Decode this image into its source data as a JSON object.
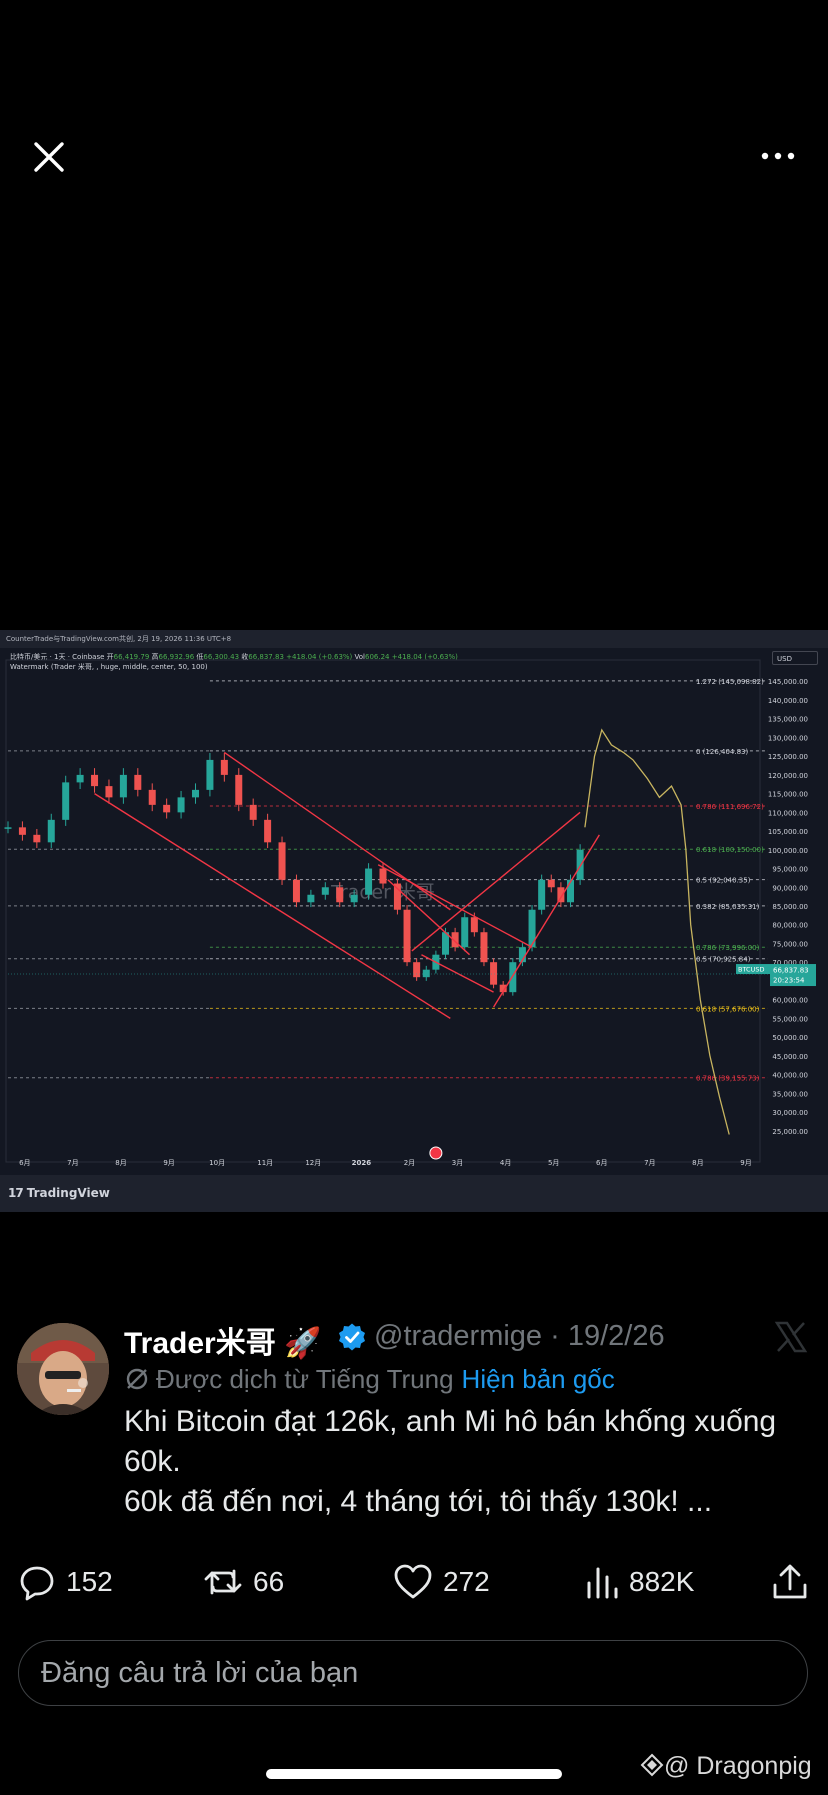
{
  "top_bar": {
    "close_icon": "close-icon",
    "more_icon": "more-horizontal-icon"
  },
  "chart_image": {
    "source_header": "CounterTrade与TradingView.com共创, 2月 19, 2026 11:36 UTC+8",
    "info_line_prefix": "比特币/美元 · 1天 · Coinbase  开",
    "open": "66,419.79",
    "high_label": "高",
    "high": "66,932.96",
    "low_label": "低",
    "low": "66,300.43",
    "close_label": "收",
    "close": "66,837.83",
    "change": "+418.04 (+0.63%)",
    "vol_label": "Vol",
    "vol": "606.24",
    "vol_change": "+418.04 (+0.63%)",
    "watermark_line": "Watermark (Trader 米哥, , huge, middle, center, 50, 100)",
    "currency": "USD",
    "watermark_text": "Trader 米哥",
    "brand": "TradingView",
    "price_tag": {
      "symbol": "BTCUSD",
      "price": "66,837.83",
      "time": "20:23:54"
    }
  },
  "chart_data": {
    "type": "line",
    "title": "",
    "xlabel": "",
    "ylabel": "",
    "x_ticks": [
      "6月",
      "7月",
      "8月",
      "9月",
      "10月",
      "11月",
      "12月",
      "2026",
      "2月",
      "3月",
      "4月",
      "5月",
      "6月",
      "7月",
      "8月",
      "9月"
    ],
    "y_ticks": [
      "145,000.00",
      "140,000.00",
      "135,000.00",
      "130,000.00",
      "125,000.00",
      "120,000.00",
      "115,000.00",
      "110,000.00",
      "105,000.00",
      "100,000.00",
      "95,000.00",
      "90,000.00",
      "85,000.00",
      "80,000.00",
      "75,000.00",
      "70,000.00",
      "65,000.00",
      "60,000.00",
      "55,000.00",
      "50,000.00",
      "45,000.00",
      "40,000.00",
      "35,000.00",
      "30,000.00",
      "25,000.00"
    ],
    "ylim": [
      22000,
      148000
    ],
    "xlim": [
      0,
      15.6
    ],
    "grid": false,
    "fib_levels": [
      {
        "label": "1.272 (145,098.82)",
        "value": 145098.82,
        "color": "#d1d4dc"
      },
      {
        "label": "0 (126,404.83)",
        "value": 126404.83,
        "color": "#d1d4dc"
      },
      {
        "label": "0.786 (111,696.72)",
        "value": 111696.72,
        "color": "#f23645"
      },
      {
        "label": "0.618 (100,150.00)",
        "value": 100150,
        "color": "#4caf50"
      },
      {
        "label": "0.5 (92,040.35)",
        "value": 92040.35,
        "color": "#d1d4dc"
      },
      {
        "label": "0.382 (85,035.31)",
        "value": 85035.31,
        "color": "#d1d4dc"
      },
      {
        "label": "0.786 (73,996.00)",
        "value": 73996,
        "color": "#4caf50"
      },
      {
        "label": "0.5 (70,925.84)",
        "value": 70925.84,
        "color": "#d1d4dc"
      },
      {
        "label": "0.618 (57,676.00)",
        "value": 57676,
        "color": "#f0c419"
      },
      {
        "label": "0.786 (39,155.73)",
        "value": 39155.73,
        "color": "#f23645"
      }
    ],
    "series": [
      {
        "style": "candles",
        "color_up": "#26a69a",
        "color_down": "#ef5350",
        "x": [
          0,
          0.3,
          0.6,
          0.9,
          1.2,
          1.5,
          1.8,
          2.1,
          2.4,
          2.7,
          3.0,
          3.3,
          3.6,
          3.9,
          4.2,
          4.5,
          4.8,
          5.1,
          5.4,
          5.7,
          6.0,
          6.3,
          6.6,
          6.9,
          7.2,
          7.5,
          7.8,
          8.1,
          8.3,
          8.5,
          8.7,
          8.9,
          9.1,
          9.3,
          9.5,
          9.7,
          9.9,
          10.1,
          10.3,
          10.5,
          10.7,
          10.9,
          11.1,
          11.3,
          11.5,
          11.7,
          11.9
        ],
        "values": [
          106000,
          104000,
          102000,
          108000,
          118000,
          120000,
          117000,
          114000,
          120000,
          116000,
          112000,
          110000,
          114000,
          116000,
          124000,
          120000,
          112000,
          108000,
          102000,
          92000,
          86000,
          88000,
          90000,
          86000,
          88000,
          95000,
          91000,
          84000,
          70000,
          66000,
          68000,
          72000,
          78000,
          74000,
          82000,
          78000,
          70000,
          64000,
          62000,
          70000,
          74000,
          84000,
          92000,
          90000,
          86000,
          92000,
          100000
        ]
      },
      {
        "style": "projection",
        "color": "#c8b560",
        "x": [
          12.0,
          12.2,
          12.35,
          12.55,
          12.8,
          13.0,
          13.3,
          13.55,
          13.8,
          14.0,
          14.1,
          14.2,
          14.4,
          14.6,
          14.8,
          15.0
        ],
        "values": [
          106000,
          125000,
          132000,
          128000,
          126000,
          124000,
          119000,
          114000,
          117000,
          112000,
          100000,
          80000,
          60000,
          45000,
          34000,
          24000
        ]
      }
    ],
    "annotations": [
      {
        "type": "trendline",
        "color": "#f23645",
        "points": [
          [
            4.5,
            126000
          ],
          [
            9.2,
            84000
          ]
        ]
      },
      {
        "type": "trendline",
        "color": "#f23645",
        "points": [
          [
            1.8,
            115000
          ],
          [
            9.2,
            55000
          ]
        ]
      },
      {
        "type": "trendline",
        "color": "#f23645",
        "points": [
          [
            7.7,
            96000
          ],
          [
            10.9,
            74000
          ]
        ]
      },
      {
        "type": "trendline",
        "color": "#f23645",
        "points": [
          [
            8.6,
            72000
          ],
          [
            10.1,
            62000
          ]
        ]
      },
      {
        "type": "trendline",
        "color": "#f23645",
        "points": [
          [
            8.4,
            73000
          ],
          [
            11.9,
            110000
          ]
        ]
      },
      {
        "type": "trendline",
        "color": "#f23645",
        "points": [
          [
            10.1,
            58000
          ],
          [
            12.3,
            104000
          ]
        ]
      },
      {
        "type": "trendline",
        "color": "#f23645",
        "points": [
          [
            7.9,
            92000
          ],
          [
            9.6,
            72000
          ]
        ]
      }
    ]
  },
  "tweet": {
    "display_name": "Trader米哥 🚀",
    "handle": "@tradermige · 19/2/26",
    "translation_note": "Được dịch từ Tiếng Trung",
    "show_original": "Hiện bản gốc",
    "text_lines": [
      "Khi Bitcoin đạt 126k, anh Mi hô bán khống xuống",
      "60k.",
      "60k đã đến nơi, 4 tháng tới, tôi thấy 130k!  ..."
    ]
  },
  "actions": {
    "replies": "152",
    "retweets": "66",
    "likes": "272",
    "views": "882K"
  },
  "reply_box": {
    "placeholder": "Đăng câu trả lời của bạn"
  },
  "watermark": "@ Dragonpig",
  "colors": {
    "accent": "#1d9bf0",
    "muted": "#71767b",
    "text": "#e7e9ea"
  }
}
